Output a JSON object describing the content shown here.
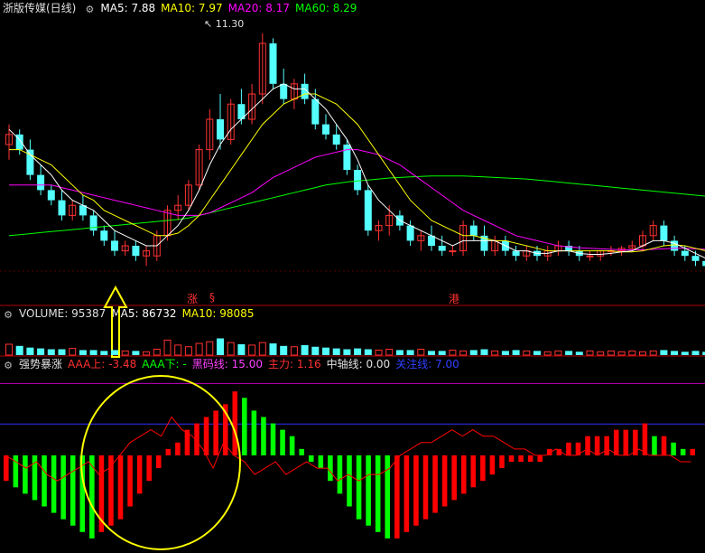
{
  "colors": {
    "up": "#ff3232",
    "down": "#54ffff",
    "ma5": "#ffffff",
    "ma10": "#ffff00",
    "ma20": "#ff00ff",
    "ma60": "#00ff00",
    "divider": "#b00000",
    "green_bar": "#00ff00",
    "red_bar": "#ff0000",
    "blue_line": "#3030ff",
    "purple_line": "#c000c0",
    "annotation": "#ffff00"
  },
  "icons": {
    "panel_toggle": "gear-icon"
  },
  "price_panel": {
    "title": "浙版传媒(日线)",
    "ma5": {
      "label": "MA5:",
      "value": "7.88"
    },
    "ma10": {
      "label": "MA10:",
      "value": "7.97"
    },
    "ma20": {
      "label": "MA20:",
      "value": "8.17"
    },
    "ma60": {
      "label": "MA60:",
      "value": "8.29"
    },
    "high_marker": "11.30",
    "signals": [
      "涨",
      "§",
      "港"
    ]
  },
  "volume_panel": {
    "volume": {
      "label": "VOLUME:",
      "value": "95387"
    },
    "ma5": {
      "label": "MA5:",
      "value": "86732"
    },
    "ma10": {
      "label": "MA10:",
      "value": "98085"
    }
  },
  "indicator_panel": {
    "title": "强势暴涨",
    "aaa_up": {
      "label": "AAA上:",
      "value": "-3.48"
    },
    "aaa_down": {
      "label": "AAA下:",
      "value": "-"
    },
    "black_horse": {
      "label": "黑码线:",
      "value": "15.00"
    },
    "main_force": {
      "label": "主力:",
      "value": "1.16"
    },
    "center_axis": {
      "label": "中轴线:",
      "value": "0.00"
    },
    "attention": {
      "label": "关注线:",
      "value": "7.00"
    }
  },
  "chart_data": {
    "type": "candlestick",
    "price_ylim": [
      6.6,
      11.6
    ],
    "candles": [
      [
        9.1,
        9.5,
        8.8,
        9.3
      ],
      [
        9.3,
        9.4,
        8.9,
        9.0
      ],
      [
        9.0,
        9.2,
        8.4,
        8.5
      ],
      [
        8.5,
        8.7,
        8.1,
        8.2
      ],
      [
        8.2,
        8.3,
        7.9,
        8.0
      ],
      [
        8.0,
        8.2,
        7.6,
        7.7
      ],
      [
        7.7,
        8.0,
        7.6,
        7.9
      ],
      [
        7.9,
        8.1,
        7.6,
        7.7
      ],
      [
        7.7,
        7.8,
        7.3,
        7.4
      ],
      [
        7.4,
        7.5,
        7.1,
        7.2
      ],
      [
        7.2,
        7.4,
        6.9,
        7.0
      ],
      [
        7.0,
        7.2,
        6.9,
        7.1
      ],
      [
        7.1,
        7.2,
        6.8,
        6.9
      ],
      [
        6.9,
        7.1,
        6.7,
        7.0
      ],
      [
        6.9,
        7.4,
        6.8,
        7.3
      ],
      [
        7.3,
        7.9,
        7.2,
        7.8
      ],
      [
        7.8,
        8.1,
        7.6,
        7.9
      ],
      [
        7.9,
        8.4,
        7.8,
        8.3
      ],
      [
        8.3,
        9.1,
        8.2,
        9.0
      ],
      [
        9.0,
        9.8,
        8.8,
        9.6
      ],
      [
        9.6,
        10.1,
        9.0,
        9.2
      ],
      [
        9.2,
        10.0,
        9.1,
        9.9
      ],
      [
        9.9,
        10.2,
        9.5,
        9.6
      ],
      [
        9.6,
        10.3,
        9.5,
        10.1
      ],
      [
        10.1,
        11.3,
        9.9,
        11.1
      ],
      [
        11.1,
        11.2,
        10.2,
        10.3
      ],
      [
        10.3,
        10.6,
        9.9,
        10.0
      ],
      [
        10.0,
        10.4,
        9.8,
        10.3
      ],
      [
        10.3,
        10.5,
        9.9,
        10.0
      ],
      [
        10.0,
        10.2,
        9.4,
        9.5
      ],
      [
        9.5,
        9.7,
        9.2,
        9.3
      ],
      [
        9.3,
        9.5,
        9.0,
        9.1
      ],
      [
        9.1,
        9.2,
        8.5,
        8.6
      ],
      [
        8.6,
        8.7,
        8.1,
        8.2
      ],
      [
        8.2,
        8.3,
        7.3,
        7.4
      ],
      [
        7.4,
        7.6,
        7.2,
        7.5
      ],
      [
        7.5,
        7.9,
        7.3,
        7.7
      ],
      [
        7.7,
        7.8,
        7.4,
        7.5
      ],
      [
        7.5,
        7.6,
        7.1,
        7.2
      ],
      [
        7.2,
        7.4,
        7.0,
        7.3
      ],
      [
        7.3,
        7.5,
        7.0,
        7.1
      ],
      [
        7.1,
        7.3,
        6.9,
        7.0
      ],
      [
        7.0,
        7.1,
        6.9,
        7.0
      ],
      [
        7.0,
        7.6,
        6.9,
        7.5
      ],
      [
        7.5,
        7.6,
        7.2,
        7.3
      ],
      [
        7.3,
        7.5,
        6.9,
        7.0
      ],
      [
        7.0,
        7.3,
        6.9,
        7.2
      ],
      [
        7.2,
        7.3,
        6.9,
        7.0
      ],
      [
        7.0,
        7.1,
        6.8,
        6.9
      ],
      [
        6.9,
        7.1,
        6.8,
        7.0
      ],
      [
        7.0,
        7.1,
        6.8,
        6.9
      ],
      [
        6.9,
        7.1,
        6.8,
        7.0
      ],
      [
        7.0,
        7.2,
        6.9,
        7.1
      ],
      [
        7.1,
        7.2,
        6.9,
        7.0
      ],
      [
        7.0,
        7.1,
        6.8,
        6.9
      ],
      [
        6.9,
        7.0,
        6.8,
        6.9
      ],
      [
        6.9,
        7.0,
        6.8,
        7.0
      ],
      [
        7.0,
        7.1,
        6.9,
        7.0
      ],
      [
        7.0,
        7.1,
        6.9,
        7.05
      ],
      [
        7.05,
        7.2,
        7.0,
        7.1
      ],
      [
        7.1,
        7.4,
        7.0,
        7.3
      ],
      [
        7.3,
        7.6,
        7.2,
        7.5
      ],
      [
        7.5,
        7.6,
        7.1,
        7.2
      ],
      [
        7.2,
        7.3,
        6.9,
        7.0
      ],
      [
        7.0,
        7.1,
        6.8,
        6.9
      ],
      [
        6.9,
        7.0,
        6.7,
        6.8
      ],
      [
        6.8,
        6.9,
        6.6,
        6.7
      ]
    ],
    "ma5": [
      9.4,
      9.2,
      8.9,
      8.7,
      8.5,
      8.2,
      8.0,
      7.9,
      7.8,
      7.6,
      7.4,
      7.3,
      7.2,
      7.1,
      7.1,
      7.3,
      7.5,
      7.8,
      8.2,
      8.7,
      9.1,
      9.4,
      9.6,
      9.8,
      10.0,
      10.2,
      10.3,
      10.2,
      10.2,
      10.0,
      9.8,
      9.5,
      9.2,
      8.8,
      8.3,
      8.0,
      7.8,
      7.6,
      7.5,
      7.4,
      7.3,
      7.2,
      7.1,
      7.2,
      7.2,
      7.2,
      7.2,
      7.1,
      7.0,
      7.0,
      6.95,
      6.95,
      7.0,
      7.0,
      6.95,
      6.93,
      6.93,
      6.95,
      6.98,
      7.0,
      7.1,
      7.2,
      7.2,
      7.15,
      7.05,
      6.95,
      6.85
    ],
    "ma10": [
      9.0,
      9.0,
      8.9,
      8.8,
      8.7,
      8.5,
      8.3,
      8.1,
      8.0,
      7.8,
      7.7,
      7.6,
      7.5,
      7.4,
      7.3,
      7.3,
      7.35,
      7.5,
      7.7,
      8.0,
      8.3,
      8.6,
      8.9,
      9.2,
      9.5,
      9.7,
      9.9,
      10.0,
      10.1,
      10.1,
      10.0,
      9.9,
      9.7,
      9.5,
      9.2,
      8.9,
      8.6,
      8.3,
      8.0,
      7.8,
      7.6,
      7.5,
      7.4,
      7.3,
      7.3,
      7.25,
      7.2,
      7.2,
      7.15,
      7.1,
      7.05,
      7.0,
      7.0,
      7.0,
      7.0,
      7.0,
      7.0,
      7.0,
      6.98,
      6.98,
      7.0,
      7.05,
      7.1,
      7.12,
      7.1,
      7.05,
      7.0
    ],
    "ma20": [
      8.3,
      8.3,
      8.3,
      8.3,
      8.3,
      8.25,
      8.2,
      8.15,
      8.1,
      8.05,
      8.0,
      7.95,
      7.9,
      7.85,
      7.8,
      7.75,
      7.7,
      7.7,
      7.7,
      7.75,
      7.85,
      7.95,
      8.05,
      8.15,
      8.3,
      8.45,
      8.55,
      8.65,
      8.75,
      8.85,
      8.9,
      8.95,
      9.0,
      9.0,
      8.95,
      8.9,
      8.8,
      8.7,
      8.55,
      8.4,
      8.25,
      8.1,
      7.95,
      7.8,
      7.7,
      7.6,
      7.5,
      7.4,
      7.3,
      7.25,
      7.2,
      7.15,
      7.1,
      7.08,
      7.06,
      7.05,
      7.04,
      7.03,
      7.02,
      7.02,
      7.02,
      7.03,
      7.04,
      7.05,
      7.05,
      7.04,
      7.03
    ],
    "ma60": [
      7.3,
      7.32,
      7.34,
      7.36,
      7.38,
      7.4,
      7.42,
      7.44,
      7.46,
      7.48,
      7.5,
      7.52,
      7.54,
      7.56,
      7.58,
      7.6,
      7.62,
      7.65,
      7.7,
      7.75,
      7.8,
      7.85,
      7.9,
      7.95,
      8.0,
      8.05,
      8.1,
      8.15,
      8.2,
      8.25,
      8.3,
      8.33,
      8.36,
      8.38,
      8.4,
      8.42,
      8.44,
      8.45,
      8.46,
      8.47,
      8.48,
      8.48,
      8.48,
      8.48,
      8.47,
      8.46,
      8.45,
      8.44,
      8.43,
      8.42,
      8.4,
      8.38,
      8.36,
      8.34,
      8.32,
      8.3,
      8.28,
      8.26,
      8.24,
      8.22,
      8.2,
      8.18,
      8.16,
      8.14,
      8.12,
      8.1,
      8.08
    ],
    "volume": [
      13,
      11,
      9,
      8,
      7,
      7,
      8,
      6,
      6,
      5,
      6,
      5,
      5,
      4,
      7,
      18,
      12,
      10,
      14,
      16,
      20,
      15,
      13,
      12,
      15,
      14,
      11,
      10,
      12,
      10,
      9,
      8,
      7,
      8,
      7,
      6,
      7,
      6,
      6,
      7,
      5,
      5,
      6,
      5,
      6,
      7,
      5,
      5,
      6,
      5,
      5,
      4,
      5,
      5,
      4,
      5,
      4,
      5,
      4,
      5,
      4,
      5,
      6,
      5,
      4,
      5,
      4
    ],
    "volume_ylim": [
      0,
      40
    ],
    "indicator": [
      -4,
      -5,
      -6,
      -7,
      -8,
      -9,
      -10,
      -11,
      -12,
      -13,
      -12,
      -11,
      -10,
      -8,
      -6,
      -4,
      -2,
      1,
      2,
      4,
      5,
      6,
      7,
      8,
      10,
      9,
      7,
      6,
      5,
      4,
      3,
      1,
      -1,
      -2,
      -4,
      -6,
      -8,
      -10,
      -11,
      -12,
      -13,
      -13,
      -12,
      -11,
      -10,
      -9,
      -8,
      -7,
      -6,
      -5,
      -4,
      -3,
      -2,
      -1,
      -1,
      -1,
      -1,
      1,
      1,
      2,
      2,
      3,
      3,
      3,
      4,
      4,
      4,
      5,
      3,
      3,
      2,
      1,
      1
    ],
    "aaa_line": [
      0,
      -1,
      -2,
      -1,
      -3,
      -4,
      -3,
      -2,
      -1,
      -3,
      -2,
      0,
      2,
      3,
      4,
      3,
      6,
      4,
      3,
      1,
      -2,
      2,
      0,
      -1,
      -3,
      -2,
      -1,
      -3,
      -2,
      -1,
      -2,
      -2,
      -4,
      -3,
      -4,
      -3,
      -3,
      -2,
      0,
      1,
      2,
      2,
      3,
      4,
      3,
      4,
      3,
      3,
      2,
      1,
      1,
      0,
      0,
      1,
      0,
      0,
      1,
      0,
      1,
      0,
      0,
      1,
      0,
      0,
      0,
      -1,
      -1
    ],
    "indicator_ylim": [
      -15,
      13
    ],
    "attention_level": 7.0,
    "black_horse_level": 15.0
  }
}
